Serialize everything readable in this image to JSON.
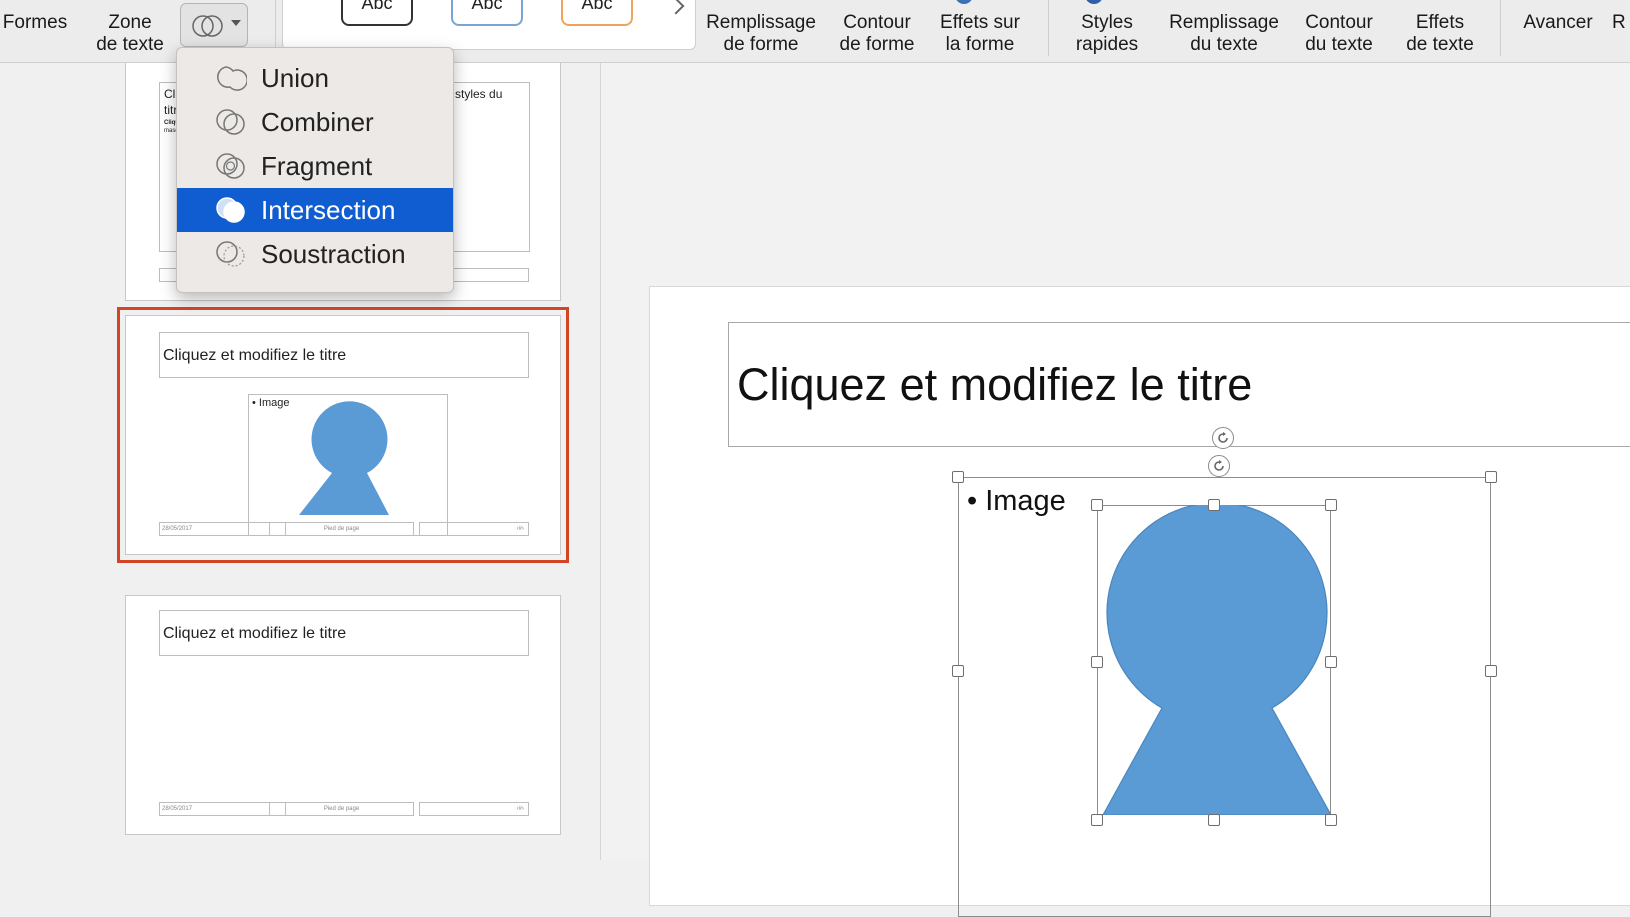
{
  "ribbon": {
    "formes": "Formes",
    "zone_texte": "Zone\nde texte",
    "style_tile_text": "Abc",
    "remplissage_forme": "Remplissage\nde forme",
    "contour_forme": "Contour\nde forme",
    "effets_forme": "Effets sur\nla forme",
    "styles_rapides": "Styles\nrapides",
    "remplissage_texte": "Remplissage\ndu texte",
    "contour_texte": "Contour\ndu texte",
    "effets_texte": "Effets\nde texte",
    "avancer": "Avancer",
    "cut_letter": "R"
  },
  "merge_menu": {
    "items": [
      {
        "label": "Union",
        "icon": "union-icon"
      },
      {
        "label": "Combiner",
        "icon": "combine-icon"
      },
      {
        "label": "Fragment",
        "icon": "fragment-icon"
      },
      {
        "label": "Intersection",
        "icon": "intersect-icon",
        "selected": true
      },
      {
        "label": "Soustraction",
        "icon": "subtract-icon"
      }
    ]
  },
  "thumbnails": {
    "thumb1": {
      "left_text_1": "Cli",
      "left_text_2": "titr",
      "left_text_3": "Clique",
      "left_text_4": "masq",
      "right_text": "es styles du"
    },
    "thumb2": {
      "title": "Cliquez et modifiez le titre",
      "bullet": "• Image",
      "date": "28/05/2017",
      "footer": "Pied de page",
      "page_num": "‹#›"
    },
    "thumb3": {
      "title": "Cliquez et modifiez le titre",
      "date": "28/05/2017",
      "footer": "Pied de page",
      "page_num": "‹#›"
    }
  },
  "slide": {
    "title": "Cliquez et modifiez le titre",
    "bullet": "• Image",
    "shape_color": "#5b9bd5"
  },
  "colors": {
    "selection_blue": "#0f5dd0",
    "thumb_selected_border": "#d24625",
    "shape_fill": "#5b9bd5"
  }
}
